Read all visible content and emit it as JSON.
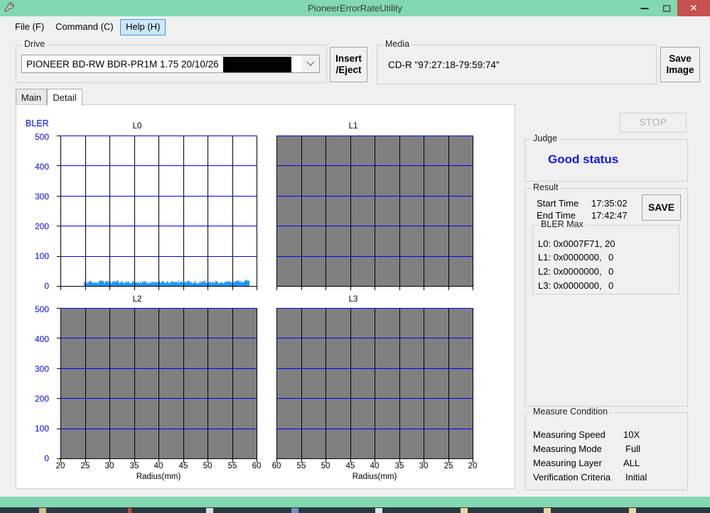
{
  "window": {
    "title": "PioneerErrorRateUtility",
    "icon": "wrench-icon",
    "minimize_label": "–",
    "maximize_label": "□",
    "close_label": "✕",
    "titlebar_color": "#82d8b0",
    "close_color": "#c75050"
  },
  "menu": [
    {
      "label": "File (F)",
      "selected": false
    },
    {
      "label": "Command (C)",
      "selected": false
    },
    {
      "label": "Help (H)",
      "selected": true
    }
  ],
  "drive": {
    "group_label": "Drive",
    "value": "PIONEER BD-RW  BDR-PR1M  1.75 20/10/26",
    "redacted": true
  },
  "insert_eject_button": {
    "label": "Insert\n/Eject"
  },
  "media": {
    "group_label": "Media",
    "value": "CD-R \"97:27:18-79:59:74\""
  },
  "save_image_button": {
    "label": "Save\nImage"
  },
  "tabs": [
    {
      "label": "Main",
      "active": false
    },
    {
      "label": "Detail",
      "active": true
    }
  ],
  "stop_button": {
    "label": "STOP",
    "disabled": true
  },
  "judge": {
    "group_label": "Judge",
    "status": "Good status",
    "status_color": "#1414ff"
  },
  "result": {
    "group_label": "Result",
    "start_time_label": "Start Time",
    "start_time_value": "17:35:02",
    "end_time_label": "End Time",
    "end_time_value": "17:42:47",
    "save_button_label": "SAVE",
    "bler_max": {
      "group_label": "BLER Max",
      "rows": [
        {
          "addr": "L0: 0x0007F71,",
          "value": "20"
        },
        {
          "addr": "L1: 0x0000000,",
          "value": "0"
        },
        {
          "addr": "L2: 0x0000000,",
          "value": "0"
        },
        {
          "addr": "L3: 0x0000000,",
          "value": "0"
        }
      ]
    }
  },
  "measure_condition": {
    "group_label": "Measure Condition",
    "rows": [
      {
        "label": "Measuring Speed",
        "value": "10X"
      },
      {
        "label": "Measuring Mode",
        "value": "Full"
      },
      {
        "label": "Measuring Layer",
        "value": "ALL"
      },
      {
        "label": "Verification Criteria",
        "value": "Initial"
      }
    ]
  },
  "chart_data": [
    {
      "type": "area",
      "title": "L0",
      "ylabel": "BLER",
      "xlabel": "Radius(mm)",
      "ylim": [
        0,
        500
      ],
      "yticks": [
        0,
        100,
        200,
        300,
        400,
        500
      ],
      "xlim": [
        20,
        60
      ],
      "xticks": [
        20,
        25,
        30,
        35,
        40,
        45,
        50,
        55,
        60
      ],
      "x_reversed": false,
      "enabled": true,
      "grid": true,
      "series_color": "#2196f3",
      "data_x_start": 24.8,
      "data_x_end": 58.4,
      "values_mean": 12,
      "values_max": 20,
      "x": [
        24.8,
        25.2,
        25.6,
        26.0,
        26.4,
        26.8,
        27.2,
        27.6,
        28.0,
        28.4,
        28.8,
        29.2,
        29.6,
        30.0,
        30.4,
        30.8,
        31.2,
        31.6,
        32.0,
        32.4,
        32.8,
        33.2,
        33.6,
        34.0,
        34.4,
        34.8,
        35.2,
        35.6,
        36.0,
        36.4,
        36.8,
        37.2,
        37.6,
        38.0,
        38.4,
        38.8,
        39.2,
        39.6,
        40.0,
        40.4,
        40.8,
        41.2,
        41.6,
        42.0,
        42.4,
        42.8,
        43.2,
        43.6,
        44.0,
        44.4,
        44.8,
        45.2,
        45.6,
        46.0,
        46.4,
        46.8,
        47.2,
        47.6,
        48.0,
        48.4,
        48.8,
        49.2,
        49.6,
        50.0,
        50.4,
        50.8,
        51.2,
        51.6,
        52.0,
        52.4,
        52.8,
        53.2,
        53.6,
        54.0,
        54.4,
        54.8,
        55.2,
        55.6,
        56.0,
        56.4,
        56.8,
        57.2,
        57.6,
        58.0,
        58.4
      ],
      "values": [
        10,
        13,
        11,
        14,
        12,
        15,
        13,
        11,
        14,
        16,
        13,
        12,
        15,
        13,
        11,
        14,
        12,
        15,
        13,
        16,
        14,
        12,
        15,
        13,
        11,
        12,
        14,
        13,
        10,
        12,
        11,
        13,
        12,
        10,
        13,
        11,
        12,
        14,
        12,
        10,
        13,
        11,
        14,
        12,
        10,
        13,
        11,
        12,
        14,
        11,
        13,
        12,
        10,
        14,
        12,
        11,
        13,
        12,
        10,
        13,
        11,
        14,
        12,
        11,
        13,
        10,
        12,
        14,
        11,
        13,
        12,
        10,
        14,
        12,
        11,
        13,
        15,
        12,
        14,
        16,
        13,
        15,
        17,
        20,
        14
      ]
    },
    {
      "type": "area",
      "title": "L1",
      "xlabel": "Radius(mm)",
      "ylim": [
        0,
        500
      ],
      "yticks": [
        0,
        100,
        200,
        300,
        400,
        500
      ],
      "xlim": [
        60,
        20
      ],
      "xticks": [
        60,
        55,
        50,
        45,
        40,
        35,
        30,
        25,
        20
      ],
      "x_reversed": true,
      "enabled": false,
      "grid": true,
      "values": []
    },
    {
      "type": "area",
      "title": "L2",
      "xlabel": "Radius(mm)",
      "ylim": [
        0,
        500
      ],
      "yticks": [
        0,
        100,
        200,
        300,
        400,
        500
      ],
      "xlim": [
        20,
        60
      ],
      "xticks": [
        20,
        25,
        30,
        35,
        40,
        45,
        50,
        55,
        60
      ],
      "x_reversed": false,
      "enabled": false,
      "grid": true,
      "values": []
    },
    {
      "type": "area",
      "title": "L3",
      "xlabel": "Radius(mm)",
      "ylim": [
        0,
        500
      ],
      "yticks": [
        0,
        100,
        200,
        300,
        400,
        500
      ],
      "xlim": [
        60,
        20
      ],
      "xticks": [
        60,
        55,
        50,
        45,
        40,
        35,
        30,
        25,
        20
      ],
      "x_reversed": true,
      "enabled": false,
      "grid": true,
      "values": []
    }
  ]
}
